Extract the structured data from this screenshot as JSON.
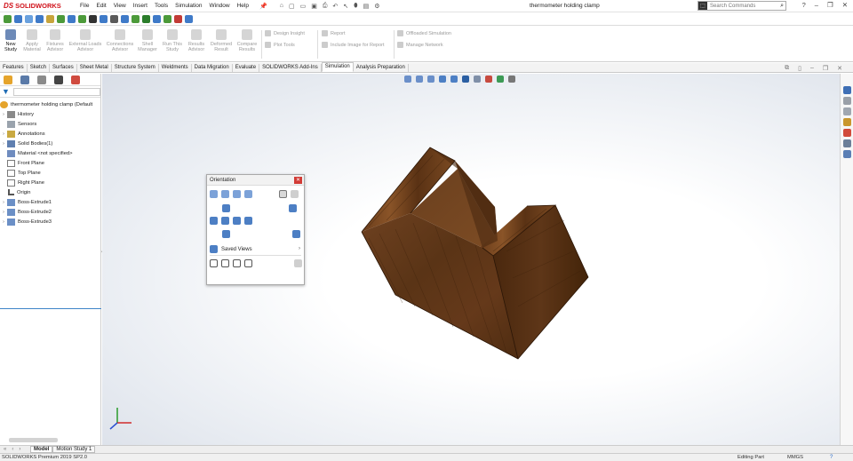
{
  "app": {
    "brand": "SOLIDWORKS",
    "document_title": "thermometer holding clamp",
    "menu": [
      "File",
      "Edit",
      "View",
      "Insert",
      "Tools",
      "Simulation",
      "Window",
      "Help"
    ],
    "search_placeholder": "Search Commands",
    "window_controls": [
      "?",
      "–",
      "❐",
      "✕"
    ]
  },
  "command_manager": {
    "buttons": [
      {
        "label": "New Study",
        "enabled": true
      },
      {
        "label": "Apply Material",
        "enabled": false
      },
      {
        "label": "Fixtures Advisor",
        "enabled": false
      },
      {
        "label": "External Loads Advisor",
        "enabled": false
      },
      {
        "label": "Connections Advisor",
        "enabled": false
      },
      {
        "label": "Shell Manager",
        "enabled": false
      },
      {
        "label": "Run This Study",
        "enabled": false
      },
      {
        "label": "Results Advisor",
        "enabled": false
      },
      {
        "label": "Deformed Result",
        "enabled": false
      },
      {
        "label": "Compare Results",
        "enabled": false
      }
    ],
    "list_items": {
      "design_insight": "Design Insight",
      "plot_tools": "Plot Tools",
      "report": "Report",
      "include_image": "Include Image for Report",
      "offload": "Offloaded Simulation",
      "manage_network": "Manage Network"
    }
  },
  "tabs": {
    "items": [
      "Features",
      "Sketch",
      "Surfaces",
      "Sheet Metal",
      "Structure System",
      "Weldments",
      "Data Migration",
      "Evaluate",
      "SOLIDWORKS Add-Ins",
      "Simulation",
      "Analysis Preparation"
    ],
    "active": "Simulation"
  },
  "feature_tree": {
    "root": "thermometer holding clamp  (Default",
    "nodes": [
      {
        "label": "History",
        "expandable": true
      },
      {
        "label": "Sensors",
        "expandable": false
      },
      {
        "label": "Annotations",
        "expandable": true
      },
      {
        "label": "Solid Bodies(1)",
        "expandable": true
      },
      {
        "label": "Material <not specified>",
        "expandable": false
      },
      {
        "label": "Front Plane",
        "expandable": false
      },
      {
        "label": "Top Plane",
        "expandable": false
      },
      {
        "label": "Right Plane",
        "expandable": false
      },
      {
        "label": "Origin",
        "expandable": false
      },
      {
        "label": "Boss-Extrude1",
        "expandable": true
      },
      {
        "label": "Boss-Extrude2",
        "expandable": true
      },
      {
        "label": "Boss-Extrude3",
        "expandable": true
      }
    ]
  },
  "orientation_dialog": {
    "title": "Orientation",
    "saved_views": "Saved Views"
  },
  "bottom_tabs": [
    "Model",
    "Motion Study 1"
  ],
  "status_bar": {
    "product": "SOLIDWORKS Premium 2019 SP2.0",
    "mode": "Editing Part",
    "units": "MMGS",
    "help": "?"
  },
  "colors": {
    "accent_blue": "#3f84c8",
    "brand_red": "#d0131b",
    "wood_light": "#7a4a22",
    "wood_mid": "#5b3417",
    "wood_dark": "#3e220d"
  }
}
